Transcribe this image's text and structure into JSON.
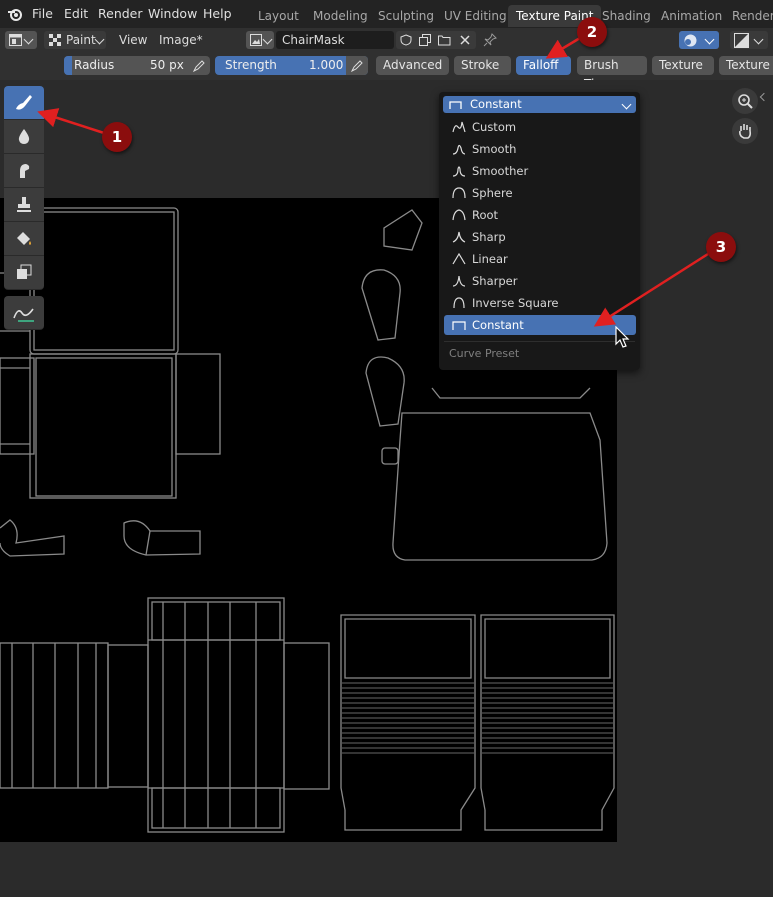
{
  "menu": {
    "file": "File",
    "edit": "Edit",
    "render": "Render",
    "window": "Window",
    "help": "Help"
  },
  "workspaces": [
    "Layout",
    "Modeling",
    "Sculpting",
    "UV Editing",
    "Texture Paint",
    "Shading",
    "Animation",
    "Renderin"
  ],
  "active_workspace": "Texture Paint",
  "header": {
    "mode": "Paint",
    "view": "View",
    "image_menu": "Image*",
    "image_name": "ChairMask"
  },
  "tool_settings": {
    "radius_label": "Radius",
    "radius_value": "50 px",
    "strength_label": "Strength",
    "strength_value": "1.000",
    "advanced": "Advanced",
    "stroke": "Stroke",
    "falloff": "Falloff",
    "brush_tip": "Brush Tip",
    "texture": "Texture",
    "texture_mask": "Texture"
  },
  "falloff_menu": {
    "current": "Constant",
    "options": [
      "Custom",
      "Smooth",
      "Smoother",
      "Sphere",
      "Root",
      "Sharp",
      "Linear",
      "Sharper",
      "Inverse Square",
      "Constant"
    ],
    "selected_index": 9,
    "footer": "Curve Preset"
  },
  "callouts": [
    "1",
    "2",
    "3"
  ],
  "colors": {
    "accent": "#4772b3",
    "callout": "#8b0d0d",
    "arrow": "#e02020"
  },
  "icons": {
    "toolbar": [
      "draw-brush-icon",
      "soften-icon",
      "smear-icon",
      "clone-stamp-icon",
      "fill-bucket-icon",
      "mask-icon",
      "annotate-icon"
    ],
    "nav": [
      "zoom-icon",
      "hand-pan-icon"
    ]
  }
}
